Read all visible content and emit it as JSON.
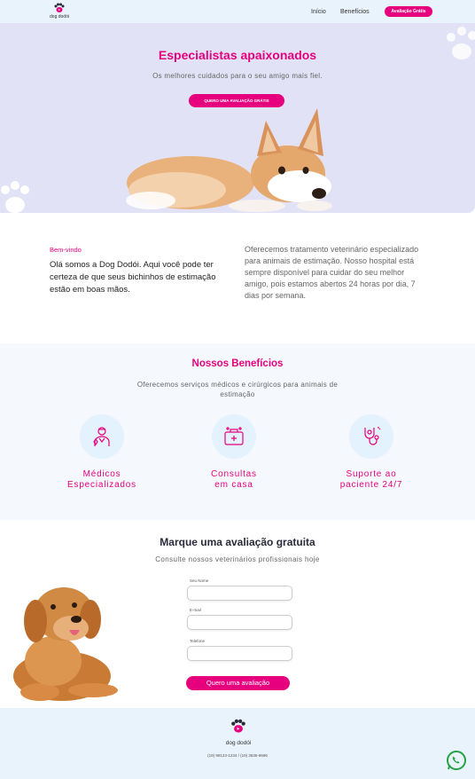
{
  "nav": {
    "logo_text": "dog dodói",
    "links": [
      "Início",
      "Benefícios"
    ],
    "cta": "Avaliação Grátis"
  },
  "hero": {
    "title": "Especialistas apaixonados",
    "subtitle": "Os melhores cuidados para o seu amigo mais fiel.",
    "cta": "QUERO UMA AVALIAÇÃO GRÁTIS"
  },
  "welcome": {
    "tag": "Bem-vindo",
    "text": "Olá somos a Dog Dodói. Aqui você pode ter certeza de que seus bichinhos de estimação estão em boas mãos.",
    "right": "Oferecemos tratamento veterinário especializado para animais de estimação. Nosso hospital está sempre disponível para cuidar do seu melhor amigo, pois estamos abertos 24 horas por dia, 7 dias por semana."
  },
  "benefits": {
    "title": "Nossos Benefícios",
    "subtitle": "Oferecemos serviços médicos e cirúrgicos para animais de estimação",
    "items": [
      {
        "label": "Médicos\nEspecializados",
        "icon": "vet-doctor-icon"
      },
      {
        "label": "Consultas\nem casa",
        "icon": "medical-kit-icon"
      },
      {
        "label": "Suporte ao\npaciente 24/7",
        "icon": "stethoscope-icon"
      }
    ]
  },
  "form": {
    "title": "Marque uma avaliação gratuita",
    "subtitle": "Consulte nossos veterinários profissionais hoje",
    "fields": [
      {
        "label": "Seu Nome",
        "value": ""
      },
      {
        "label": "E-mail",
        "value": ""
      },
      {
        "label": "Telefone",
        "value": ""
      }
    ],
    "submit": "Quero uma avaliação"
  },
  "footer": {
    "logo_text": "dog dodói",
    "phones": "(19) 99123-1234 / (19) 3636-9696"
  },
  "colors": {
    "accent": "#e6007e",
    "hero_bg": "#e2e2f6",
    "nav_bg": "#e8f3fb"
  }
}
